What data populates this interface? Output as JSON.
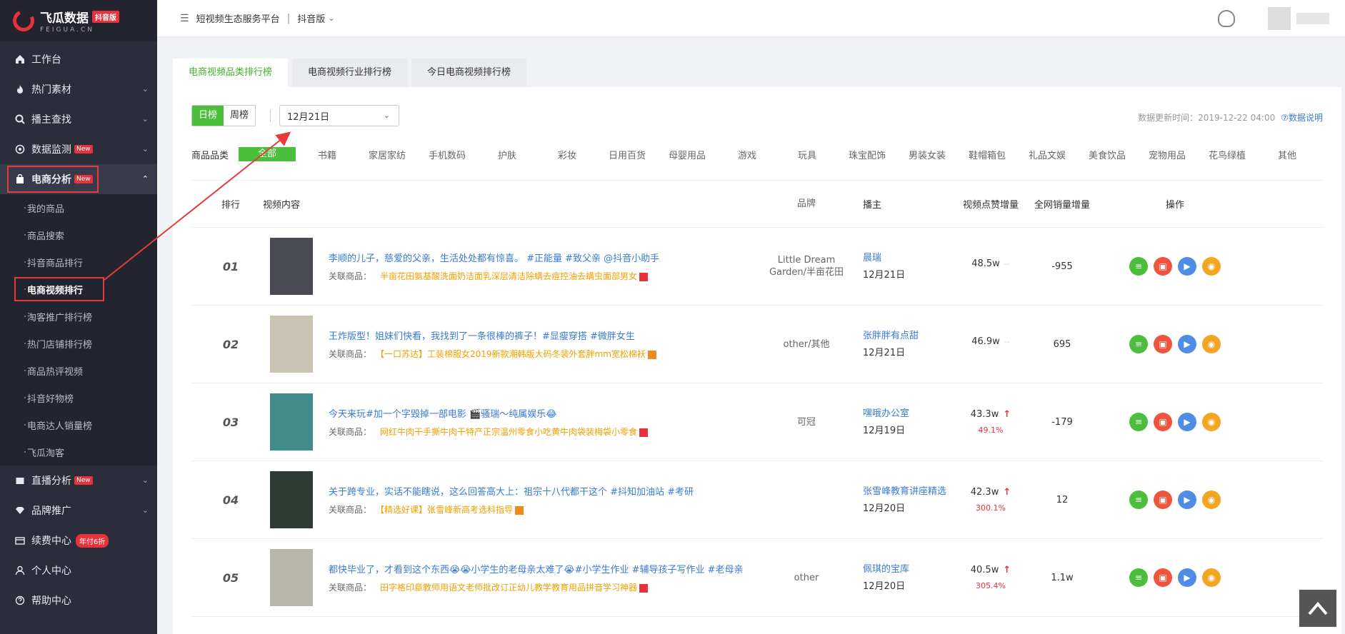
{
  "brand": {
    "name": "飞瓜数据",
    "badge": "抖音版",
    "sub": "FEIGUA.CN"
  },
  "sidebar": {
    "items": [
      {
        "label": "工作台",
        "icon": "home-icon"
      },
      {
        "label": "热门素材",
        "icon": "fire-icon",
        "chev": "⌄"
      },
      {
        "label": "播主查找",
        "icon": "search-icon",
        "chev": "⌄"
      },
      {
        "label": "数据监测",
        "icon": "monitor-icon",
        "badge": "New",
        "chev": "⌄"
      },
      {
        "label": "电商分析",
        "icon": "bag-icon",
        "badge": "New",
        "chev": "⌃"
      },
      {
        "label": "直播分析",
        "icon": "live-icon",
        "badge": "New",
        "chev": "⌄"
      },
      {
        "label": "品牌推广",
        "icon": "diamond-icon",
        "chev": "⌄"
      },
      {
        "label": "续费中心",
        "icon": "card-icon",
        "badge": "年付6折"
      },
      {
        "label": "个人中心",
        "icon": "user-icon"
      },
      {
        "label": "帮助中心",
        "icon": "help-icon"
      }
    ],
    "sub": [
      "我的商品",
      "商品搜索",
      "抖音商品排行",
      "电商视频排行",
      "淘客推广排行榜",
      "热门店铺排行榜",
      "商品热评视频",
      "抖音好物榜",
      "电商达人销量榜",
      "飞瓜淘客"
    ]
  },
  "header": {
    "title": "短视频生态服务平台",
    "sep": "|",
    "version": "抖音版"
  },
  "tabs": [
    "电商视频品类排行榜",
    "电商视频行业排行榜",
    "今日电商视频排行榜"
  ],
  "toolbar": {
    "daily": "日榜",
    "weekly": "周榜",
    "date": "12月21日",
    "update_label": "数据更新时间：2019-12-22 04:00",
    "help": "⑦数据说明"
  },
  "categories": {
    "label": "商品品类",
    "items": [
      "全部",
      "书籍",
      "家居家纺",
      "手机数码",
      "护肤",
      "彩妆",
      "日用百货",
      "母婴用品",
      "游戏",
      "玩具",
      "珠宝配饰",
      "男装女装",
      "鞋帽箱包",
      "礼品文娱",
      "美食饮品",
      "宠物用品",
      "花鸟绿植",
      "其他"
    ]
  },
  "table": {
    "headers": {
      "rank": "排行",
      "video": "视频内容",
      "brand": "品牌",
      "anchor": "播主",
      "likes": "视频点赞增量",
      "sales": "全网销量增量",
      "op": "操作"
    },
    "prod_label": "关联商品：",
    "rows": [
      {
        "rank": "01",
        "title": "李顺的儿子，慈爱的父亲，生活处处都有惊喜。 #正能量 #致父亲 @抖音小助手",
        "product": "半亩花田氨基酸洗面奶洁面乳深层清洁除螨去痘控油去螨虫面部男女",
        "brand": "Little Dream Garden/半亩花田",
        "anchor": "晨瑞",
        "date": "12月21日",
        "likes": "48.5w",
        "trend": "--",
        "pct": "",
        "sales": "-955",
        "thumb": "#4a4a52"
      },
      {
        "rank": "02",
        "title": "王炸版型！姐妹们快看，我找到了一条很棒的裤子！#显瘦穿搭 #微胖女生",
        "product": "【一口苏达】工装棉服女2019新款潮韩版大码冬装外套胖mm宽松棉袄",
        "brand": "other/其他",
        "anchor": "张胖胖有点甜",
        "date": "12月21日",
        "likes": "46.9w",
        "trend": "--",
        "pct": "",
        "sales": "695",
        "thumb": "#c9c4b4"
      },
      {
        "rank": "03",
        "title": "今天来玩#加一个字毁掉一部电影 🎬骚瑞～纯属娱乐😂",
        "product": "网红牛肉干手撕牛肉干特产正宗温州零食小吃黄牛肉袋装梅袋小零食",
        "brand": "可冠",
        "anchor": "嘿哦办公室",
        "date": "12月19日",
        "likes": "43.3w",
        "trend": "↑",
        "pct": "49.1%",
        "sales": "-179",
        "thumb": "#3f8c8a"
      },
      {
        "rank": "04",
        "title": "关于跨专业，实话不能瞎说，这么回答高大上：祖宗十八代都干这个 #抖知加油站 #考研",
        "product": "【精选好课】张雪峰新高考选科指导",
        "brand": "",
        "anchor": "张雪峰教育讲座精选",
        "date": "12月20日",
        "likes": "42.3w",
        "trend": "↑",
        "pct": "300.1%",
        "sales": "12",
        "thumb": "#2e3a33"
      },
      {
        "rank": "05",
        "title": "都快毕业了，才看到这个东西😭😭小学生的老母亲太难了😭#小学生作业 #辅导孩子写作业 #老母亲",
        "product": "田字格印章教师用语文老师批改订正幼儿教学教育用品拼音学习神器",
        "brand": "other",
        "anchor": "佩琪的宝库",
        "date": "12月20日",
        "likes": "40.5w",
        "trend": "↑",
        "pct": "305.4%",
        "sales": "1.1w",
        "thumb": "#b8b5ac"
      }
    ]
  }
}
